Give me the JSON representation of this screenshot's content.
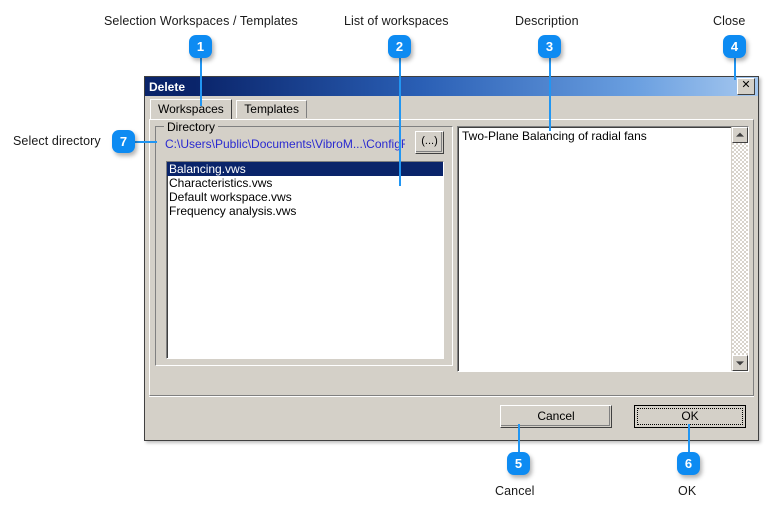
{
  "annotations": [
    {
      "number": "1",
      "label": "Selection Workspaces / Templates"
    },
    {
      "number": "2",
      "label": "List of workspaces"
    },
    {
      "number": "3",
      "label": "Description"
    },
    {
      "number": "4",
      "label": "Close"
    },
    {
      "number": "5",
      "label": "Cancel"
    },
    {
      "number": "6",
      "label": "OK"
    },
    {
      "number": "7",
      "label": "Select directory"
    }
  ],
  "accent_color": "#0d8bf2",
  "dialog": {
    "title": "Delete",
    "close_label": "✕",
    "tabs": [
      {
        "label": "Workspaces",
        "active": true
      },
      {
        "label": "Templates",
        "active": false
      }
    ],
    "directory_group": {
      "title": "Directory",
      "path": "C:\\Users\\Public\\Documents\\VibroM...\\ConfigRT",
      "browse_label": "(...)"
    },
    "workspace_list": [
      {
        "name": "Balancing.vws",
        "selected": true
      },
      {
        "name": "Characteristics.vws",
        "selected": false
      },
      {
        "name": "Default workspace.vws",
        "selected": false
      },
      {
        "name": "Frequency analysis.vws",
        "selected": false
      }
    ],
    "description": {
      "text": "Two-Plane Balancing of radial fans"
    },
    "buttons": {
      "cancel_label": "Cancel",
      "ok_label": "OK"
    }
  }
}
